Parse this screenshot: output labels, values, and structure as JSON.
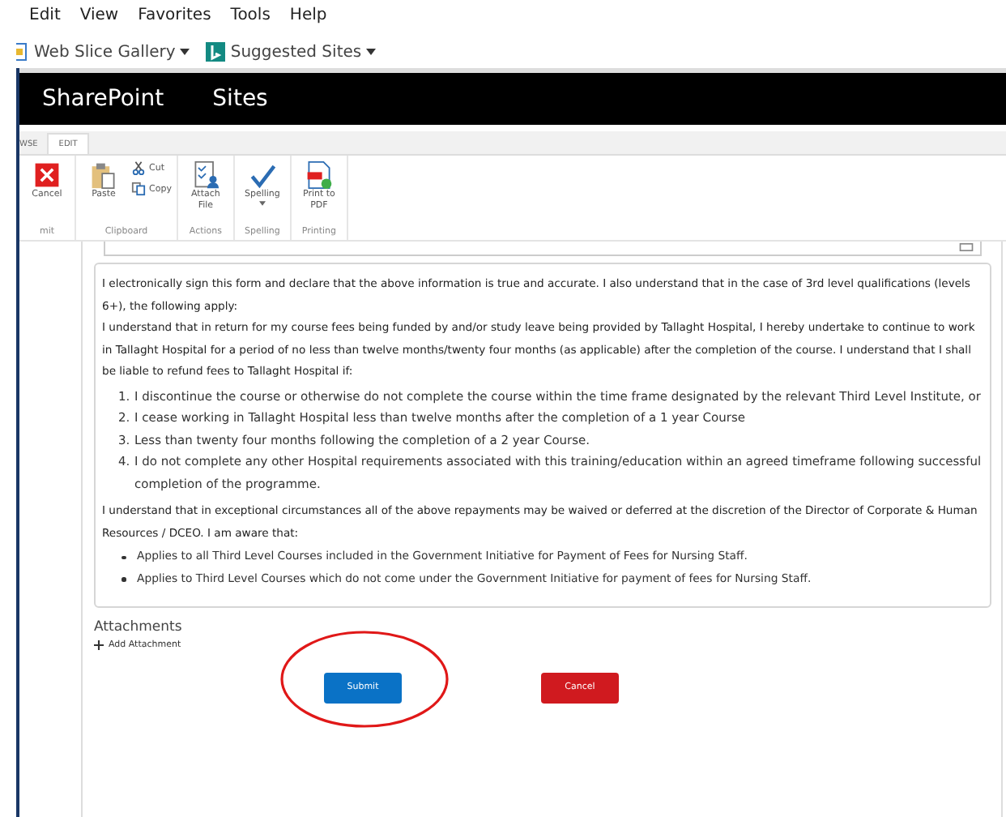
{
  "menu_bar": [
    "Edit",
    "View",
    "Favorites",
    "Tools",
    "Help"
  ],
  "favorites_bar": [
    {
      "label": "Web Slice Gallery",
      "kind": "web-slice"
    },
    {
      "label": "Suggested Sites",
      "kind": "bing"
    }
  ],
  "suite_bar": {
    "brand": "SharePoint",
    "links": [
      "Sites"
    ]
  },
  "ribbon": {
    "tabs": [
      {
        "label": "WSE",
        "selected": false
      },
      {
        "label": "EDIT",
        "selected": true
      }
    ],
    "groups": [
      {
        "label": "mit",
        "commands": [
          {
            "label": "Cancel",
            "kind": "cancel"
          }
        ]
      },
      {
        "label": "Clipboard",
        "commands": [
          {
            "label": "Paste",
            "kind": "paste"
          },
          {
            "label": "Cut",
            "kind": "cut"
          },
          {
            "label": "Copy",
            "kind": "copy"
          }
        ]
      },
      {
        "label": "Actions",
        "commands": [
          {
            "label": "Attach File",
            "kind": "attach"
          }
        ]
      },
      {
        "label": "Spelling",
        "commands": [
          {
            "label": "Spelling",
            "kind": "spelling"
          }
        ]
      },
      {
        "label": "Printing",
        "commands": [
          {
            "label": "Print to PDF",
            "kind": "pdf"
          }
        ]
      }
    ]
  },
  "declaration": [
    {
      "kind": "paragraph",
      "text": "I electronically sign this form and declare that the above information is true and accurate. I also understand that in the case of 3rd level qualifications (levels 6+), the following apply:"
    },
    {
      "kind": "paragraph",
      "text": "I understand that in return for my course fees being funded by and/or study leave being provided by Tallaght Hospital, I hereby undertake to continue to work in Tallaght Hospital for a period of no less than twelve months/twenty four months (as applicable) after the completion of the course. I understand that I shall be liable to refund fees to Tallaght Hospital if:"
    },
    {
      "kind": "numbered",
      "items": [
        {
          "number": "1.",
          "text": "I discontinue the course or otherwise do not complete the course within the time frame designated by the relevant Third Level Institute, or"
        },
        {
          "number": "2.",
          "text": "I cease working in Tallaght Hospital less than twelve months after the completion of a 1 year Course"
        },
        {
          "number": "3.",
          "text": "Less than twenty four months following the completion of a 2 year Course."
        },
        {
          "number": "4.",
          "text": "I do not complete any other Hospital requirements associated with this training/education within an agreed timeframe following successful completion of the programme."
        }
      ]
    },
    {
      "kind": "paragraph",
      "text": "I understand that in exceptional circumstances all of the above repayments may be waived or deferred at the discretion of the Director of Corporate & Human Resources / DCEO. I am aware that:"
    },
    {
      "kind": "bulleted",
      "items": [
        {
          "text": "Applies to all Third Level Courses included in the Government Initiative for Payment of Fees for Nursing Staff."
        },
        {
          "text": "Applies to Third Level Courses which do not come under the Government Initiative for payment of fees for Nursing Staff."
        }
      ]
    }
  ],
  "attachments": {
    "heading": "Attachments",
    "add_link": "Add Attachment"
  },
  "buttons": [
    {
      "label": "Submit",
      "kind": "primary",
      "highlighted": true
    },
    {
      "label": "Cancel",
      "kind": "danger",
      "highlighted": false
    }
  ]
}
